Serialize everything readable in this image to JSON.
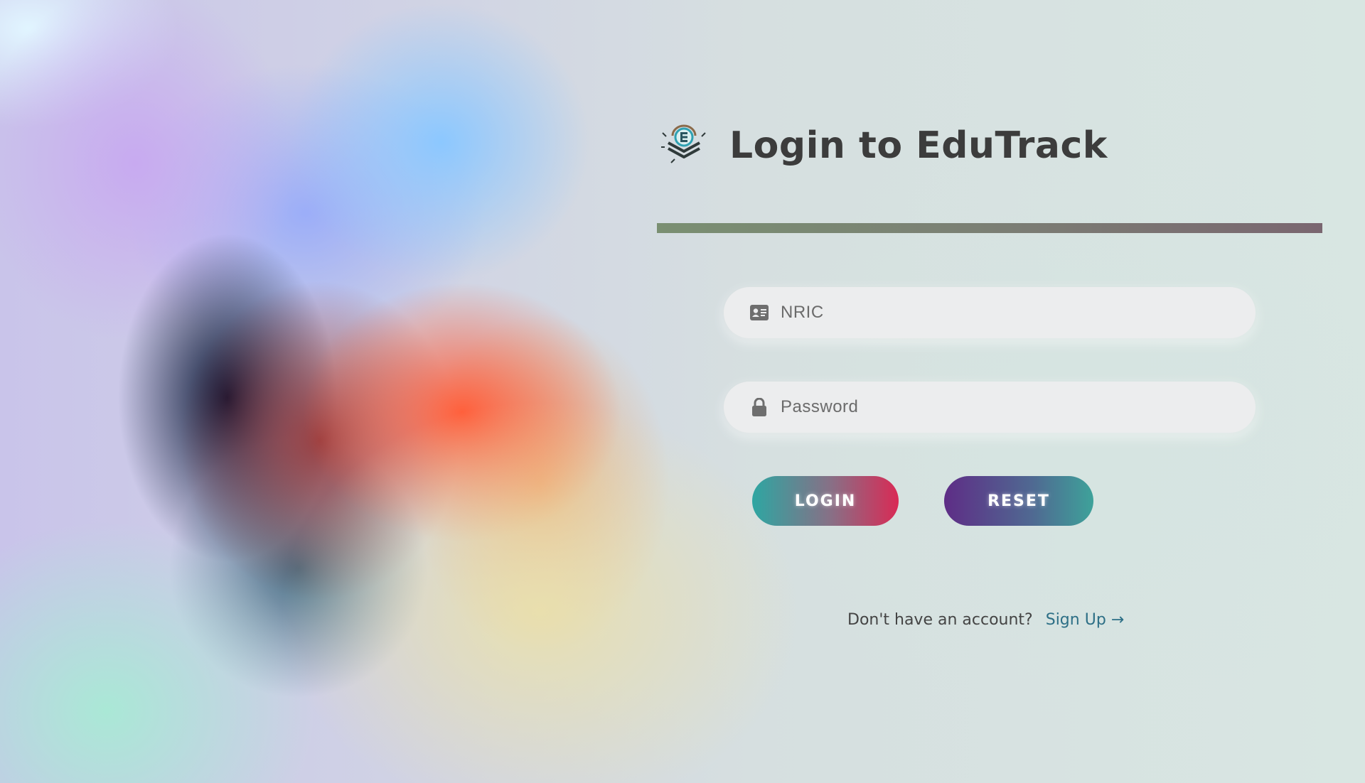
{
  "header": {
    "title": "Login to EduTrack",
    "logo_icon": "edutrack-logo-icon"
  },
  "form": {
    "nric": {
      "placeholder": "NRIC",
      "value": "",
      "icon": "id-card-icon"
    },
    "password": {
      "placeholder": "Password",
      "value": "",
      "icon": "lock-icon"
    }
  },
  "buttons": {
    "login_label": "LOGIN",
    "reset_label": "RESET"
  },
  "signup": {
    "prompt": "Don't have an account?",
    "link_label": "Sign Up →"
  },
  "colors": {
    "title": "#3c3c3c",
    "link": "#2d6f86",
    "login_gradient_start": "#2ea6a2",
    "login_gradient_end": "#d92a55",
    "reset_gradient_start": "#5e2d86",
    "reset_gradient_end": "#3ea29a"
  }
}
